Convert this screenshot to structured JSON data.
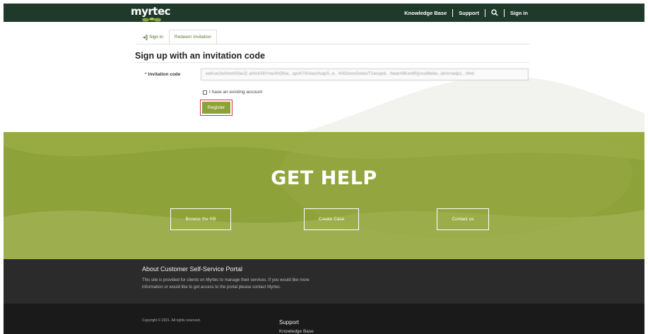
{
  "header": {
    "logo_text": "myrtec",
    "nav": [
      "Knowledge Base",
      "Support",
      "Sign in"
    ],
    "search_icon": "search-icon"
  },
  "tabs": {
    "signin": "Sign in",
    "redeem": "Redeem invitation"
  },
  "form": {
    "heading": "Sign up with an invitation code",
    "invitation_label": "Invitation code",
    "required_mark": "*",
    "invitation_value": "eeKxe2wXmnhSiwJ2 aHn4X6YnwXhDKw...xpvh7lAAwzHutpS..e.. h0iDmnrOvkesT2wsqcb.. hwarHlKxmRi]cnsiMebu..idrnrrwdp1...tHnt",
    "existing_account_label": "I have an existing account",
    "register_label": "Register"
  },
  "help": {
    "title": "GET HELP",
    "buttons": [
      "Browse the KB",
      "Create Case",
      "Contact us"
    ]
  },
  "footer": {
    "about_title": "About Customer Self-Service Portal",
    "about_text": "This site is provided for clients on Myrtec to manage their services. If you would like more information or would like to get access to the portal please contact Myrtec.",
    "copyright": "Copyright © 2021. All rights reserved.",
    "support_title": "Support",
    "support_link": "Knowledge Base"
  },
  "colors": {
    "brand_dark": "#1f3a2a",
    "brand_green": "#8ea23a",
    "highlight": "#d9344a",
    "footer_dark": "#2b2b2b"
  }
}
